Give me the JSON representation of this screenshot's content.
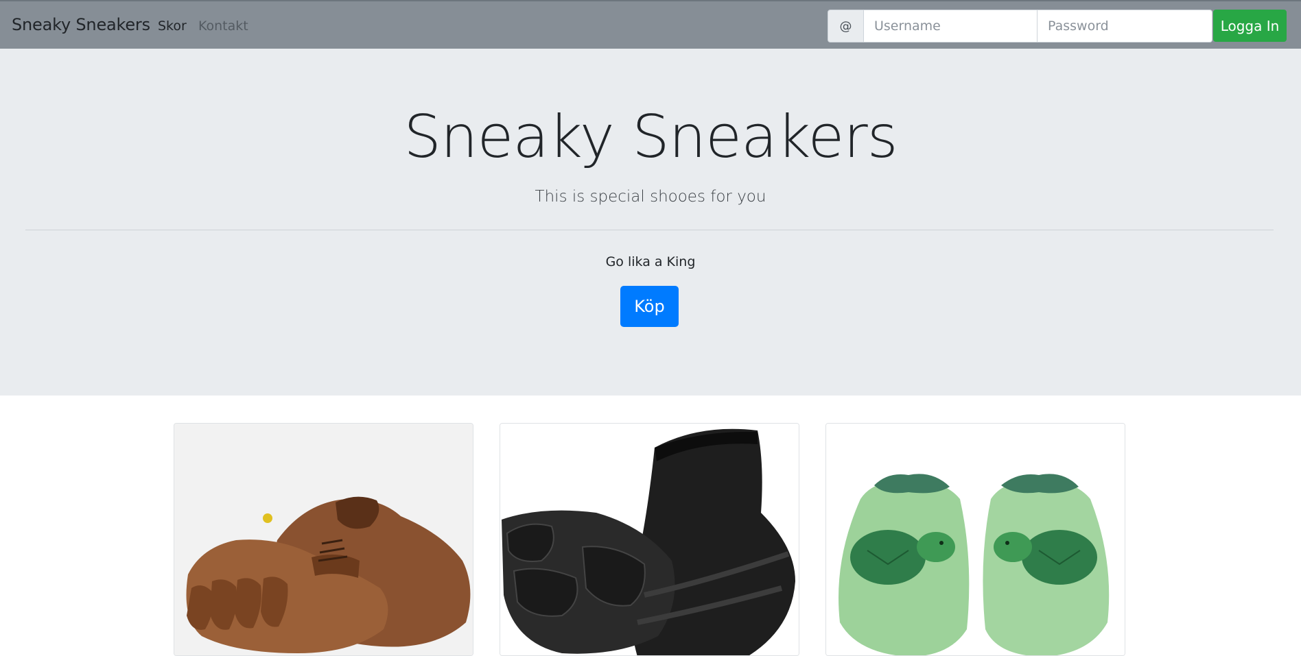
{
  "navbar": {
    "brand": "Sneaky Sneakers",
    "links": [
      {
        "label": "Skor"
      },
      {
        "label": "Kontakt"
      }
    ],
    "login": {
      "prefix": "@",
      "username_placeholder": "Username",
      "password_placeholder": "Password",
      "button_label": "Logga In"
    }
  },
  "colors": {
    "navbar_bg": "#868e96",
    "jumbotron_bg": "#e9ecef",
    "primary": "#007bff",
    "success": "#28a745"
  },
  "hero": {
    "title": "Sneaky Sneakers",
    "lead": "This is special shooes for you",
    "text": "Go lika a King",
    "button_label": "Köp"
  },
  "products": [
    {
      "image": "brown-toe-shoe-image"
    },
    {
      "image": "black-toe-sock-shoe-image"
    },
    {
      "image": "green-turtle-baby-shoes-image"
    }
  ]
}
